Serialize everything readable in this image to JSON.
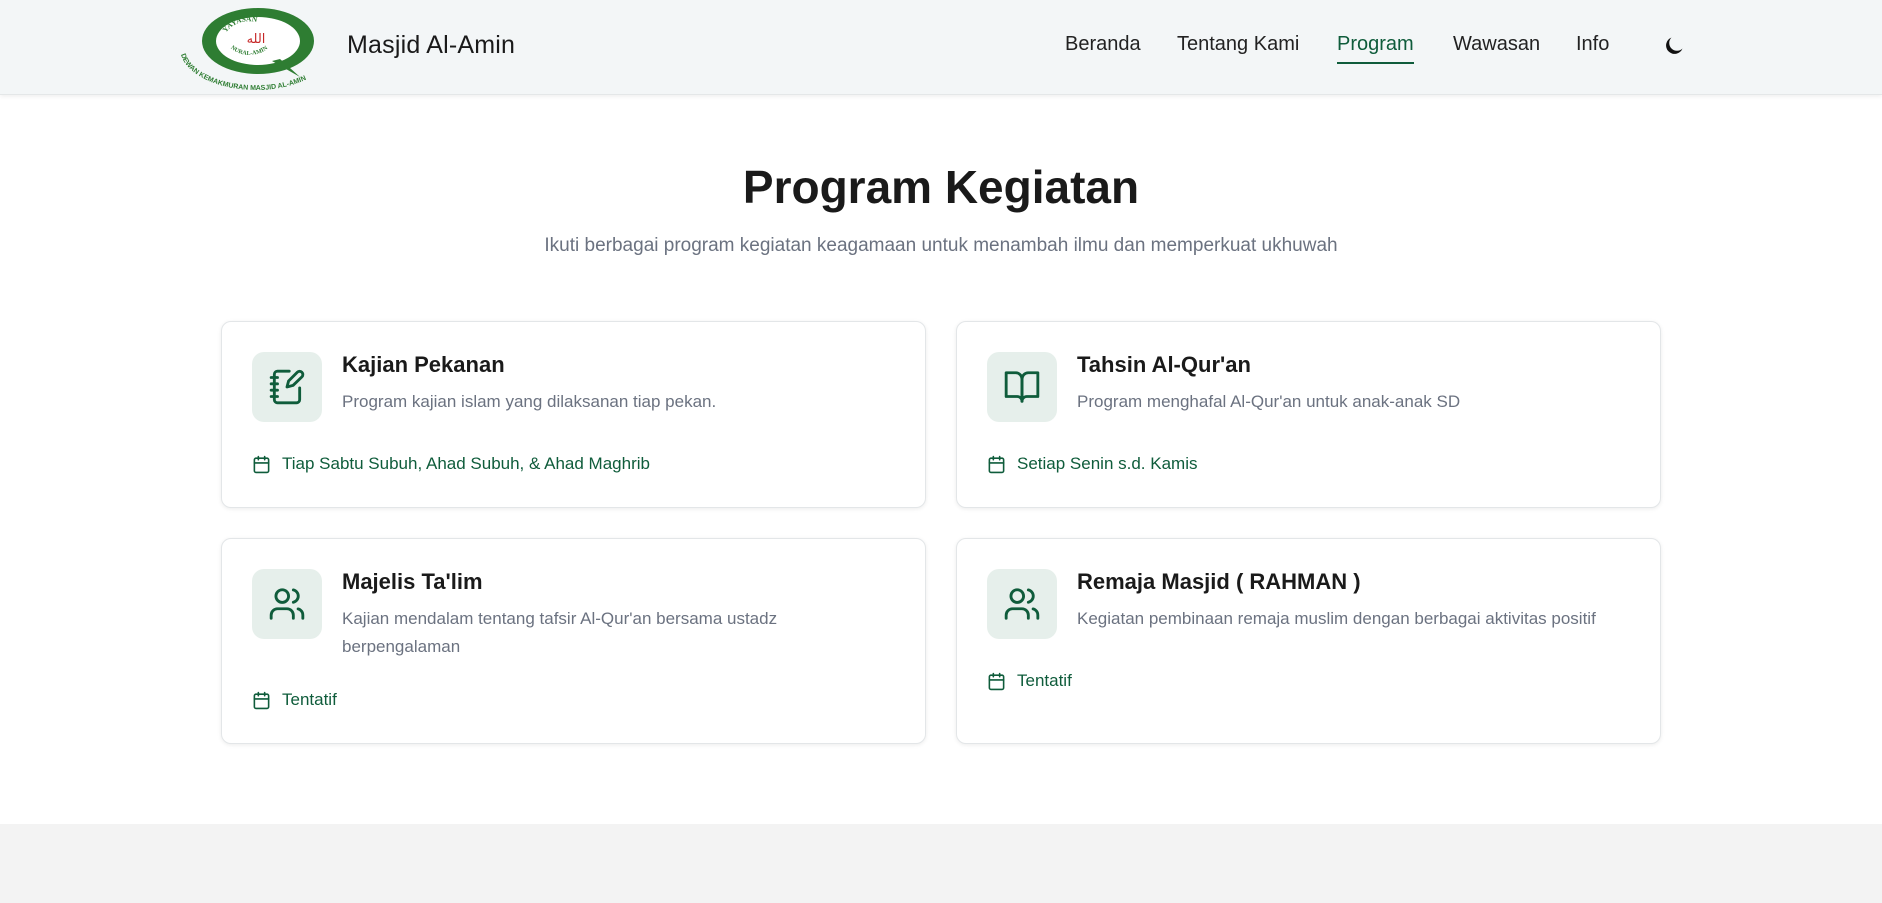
{
  "header": {
    "logo_text_top": "YAYASAN",
    "logo_text_middle": "NURAL-AMIN",
    "logo_text_bottom": "DEWAN KEMAKMURAN MASJID AL-AMIN",
    "brand": "Masjid Al-Amin",
    "nav": [
      {
        "label": "Beranda",
        "active": false
      },
      {
        "label": "Tentang Kami",
        "active": false
      },
      {
        "label": "Program",
        "active": true
      },
      {
        "label": "Wawasan",
        "active": false
      },
      {
        "label": "Info",
        "active": false
      }
    ],
    "theme_toggle_icon": "moon-icon"
  },
  "section": {
    "title": "Program Kegiatan",
    "subtitle": "Ikuti berbagai program kegiatan keagamaan untuk menambah ilmu dan memperkuat ukhuwah"
  },
  "programs": [
    {
      "icon": "notebook-pen-icon",
      "title": "Kajian Pekanan",
      "description": "Program kajian islam yang dilaksanan tiap pekan.",
      "schedule": "Tiap Sabtu Subuh, Ahad Subuh, & Ahad Maghrib"
    },
    {
      "icon": "open-book-icon",
      "title": "Tahsin Al-Qur'an",
      "description": "Program menghafal Al-Qur'an untuk anak-anak SD",
      "schedule": "Setiap Senin s.d. Kamis"
    },
    {
      "icon": "users-icon",
      "title": "Majelis Ta'lim",
      "description": "Kajian mendalam tentang tafsir Al-Qur'an bersama ustadz berpengalaman",
      "schedule": "Tentatif"
    },
    {
      "icon": "users-icon",
      "title": "Remaja Masjid ( RAHMAN )",
      "description": "Kegiatan pembinaan remaja muslim dengan berbagai aktivitas positif",
      "schedule": "Tentatif"
    }
  ],
  "colors": {
    "accent": "#0f5c3b",
    "logo_green": "#2e7d32",
    "icon_bg": "#e6efeb",
    "muted_text": "#6b7280",
    "header_bg": "#f3f6f7"
  }
}
